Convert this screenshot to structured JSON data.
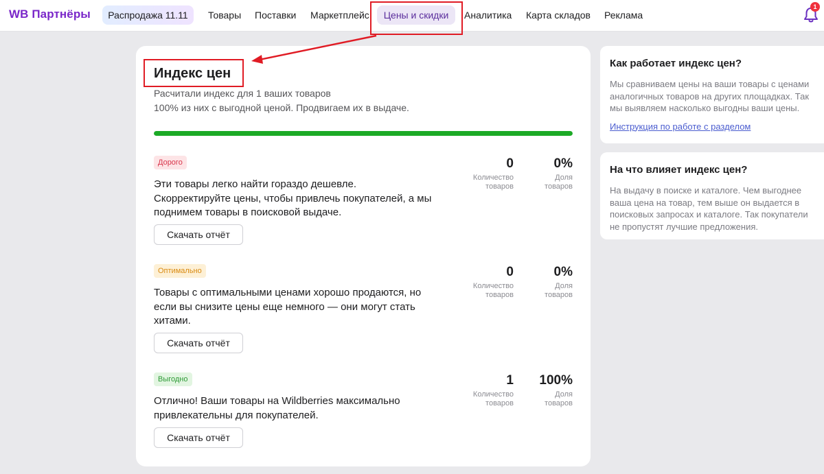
{
  "header": {
    "logo": "WB Партнёры",
    "promo": "Распродажа 11.11",
    "nav": [
      "Товары",
      "Поставки",
      "Маркетплейс",
      "Цены и скидки",
      "Аналитика",
      "Карта складов",
      "Реклама"
    ],
    "active_nav": "Цены и скидки",
    "notifications_count": "1"
  },
  "main": {
    "title": "Индекс цен",
    "subtitle_1": "Расчитали индекс для 1 ваших товаров",
    "subtitle_2": "100% из них с выгодной ценой. Продвигаем их в выдаче.",
    "progress_green_fraction": 1.0,
    "sections": [
      {
        "badge": "Дорого",
        "lines": [
          "Эти товары легко найти гораздо дешевле.",
          "Скорректируйте цены, чтобы привлечь покупателей, а мы",
          "поднимем товары в поисковой выдаче."
        ],
        "button": "Скачать отчёт",
        "count": "0",
        "count_label_1": "Количество",
        "count_label_2": "товаров",
        "share": "0%",
        "share_label_1": "Доля",
        "share_label_2": "товаров"
      },
      {
        "badge": "Оптимально",
        "lines": [
          "Товары с оптимальными ценами хорошо продаются, но",
          "если вы снизите цены еще немного — они могут стать",
          "хитами."
        ],
        "button": "Скачать отчёт",
        "count": "0",
        "count_label_1": "Количество",
        "count_label_2": "товаров",
        "share": "0%",
        "share_label_1": "Доля",
        "share_label_2": "товаров"
      },
      {
        "badge": "Выгодно",
        "lines": [
          "Отлично! Ваши товары на Wildberries максимально",
          "привлекательны для покупателей."
        ],
        "button": "Скачать отчёт",
        "count": "1",
        "count_label_1": "Количество",
        "count_label_2": "товаров",
        "share": "100%",
        "share_label_1": "Доля",
        "share_label_2": "товаров"
      }
    ]
  },
  "sidebar": {
    "card1": {
      "title": "Как работает индекс цен?",
      "text": "Мы сравниваем цены на ваши товары с ценами аналогичных товаров на других площадках. Так мы выявляем насколько выгодны ваши цены.",
      "link": "Инструкция по работе с разделом"
    },
    "card2": {
      "title": "На что влияет индекс цен?",
      "text": "На выдачу в поиске и каталоге. Чем выгоднее ваша цена на товар, тем выше он выдается в поисковых запросах и каталоге. Так покупатели не пропустят лучшие предложения."
    }
  },
  "colors": {
    "brand": "#7a27c9",
    "progress": "#1caa26",
    "annotation": "#e01b24"
  }
}
